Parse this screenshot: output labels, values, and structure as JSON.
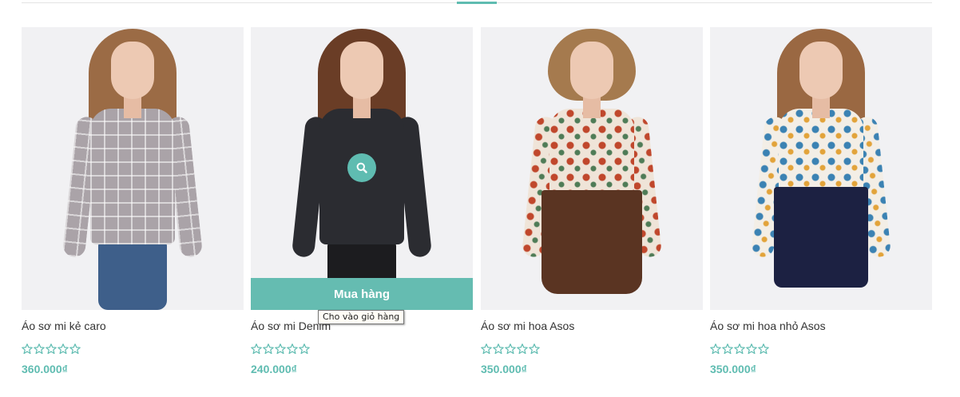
{
  "products": [
    {
      "name": "Áo sơ mi kẻ caro",
      "price": "360.000₫",
      "rating": 0
    },
    {
      "name": "Áo sơ mi Denim",
      "price": "240.000₫",
      "rating": 0,
      "buy_label": "Mua hàng",
      "tooltip": "Cho vào giỏ hàng"
    },
    {
      "name": "Áo sơ mi hoa Asos",
      "price": "350.000₫",
      "rating": 0
    },
    {
      "name": "Áo sơ mi hoa nhỏ Asos",
      "price": "350.000₫",
      "rating": 0
    }
  ],
  "colors": {
    "accent": "#5fbcb1",
    "button": "#65bcb1",
    "text": "#333333"
  },
  "icons": {
    "quickview": "search-icon",
    "rating": "star-outline-icon"
  }
}
